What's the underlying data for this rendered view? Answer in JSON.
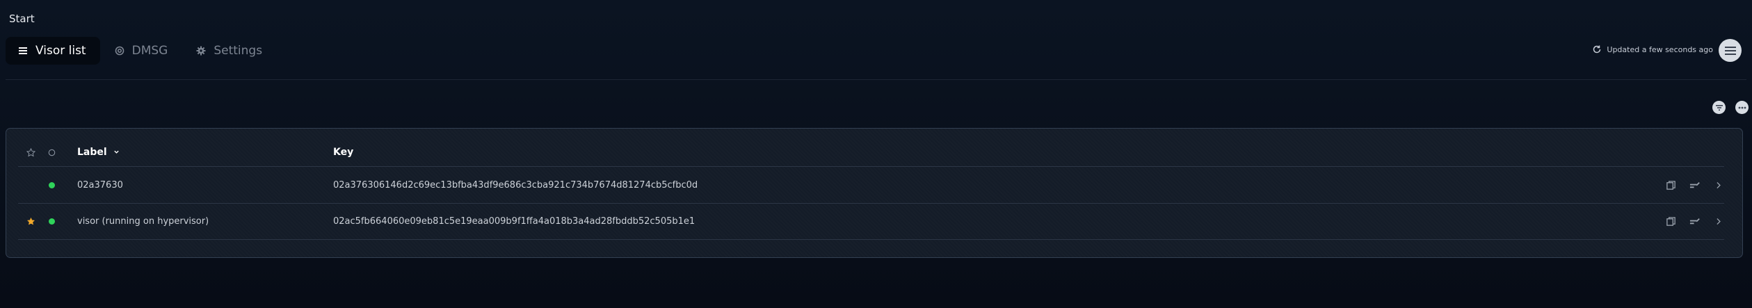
{
  "breadcrumb": "Start",
  "tabs": [
    {
      "label": "Visor list",
      "icon": "list-icon",
      "active": true
    },
    {
      "label": "DMSG",
      "icon": "at-icon",
      "active": false
    },
    {
      "label": "Settings",
      "icon": "gear-icon",
      "active": false
    }
  ],
  "status": {
    "text": "Updated a few seconds ago",
    "icon": "refresh-icon"
  },
  "table": {
    "headers": {
      "label": "Label",
      "key": "Key"
    },
    "rows": [
      {
        "starred": false,
        "online": true,
        "label": "02a37630",
        "key": "02a376306146d2c69ec13bfba43df9e686c3cba921c734b7674d81274cb5cfbc0d"
      },
      {
        "starred": true,
        "online": true,
        "label": "visor (running on hypervisor)",
        "key": "02ac5fb664060e09eb81c5e19eaa009b9f1ffa4a018b3a4ad28fbddb52c505b1e1"
      }
    ]
  },
  "colors": {
    "accent_green": "#2fd35a",
    "star_gold": "#f2a92b",
    "background": "#0b1422"
  }
}
